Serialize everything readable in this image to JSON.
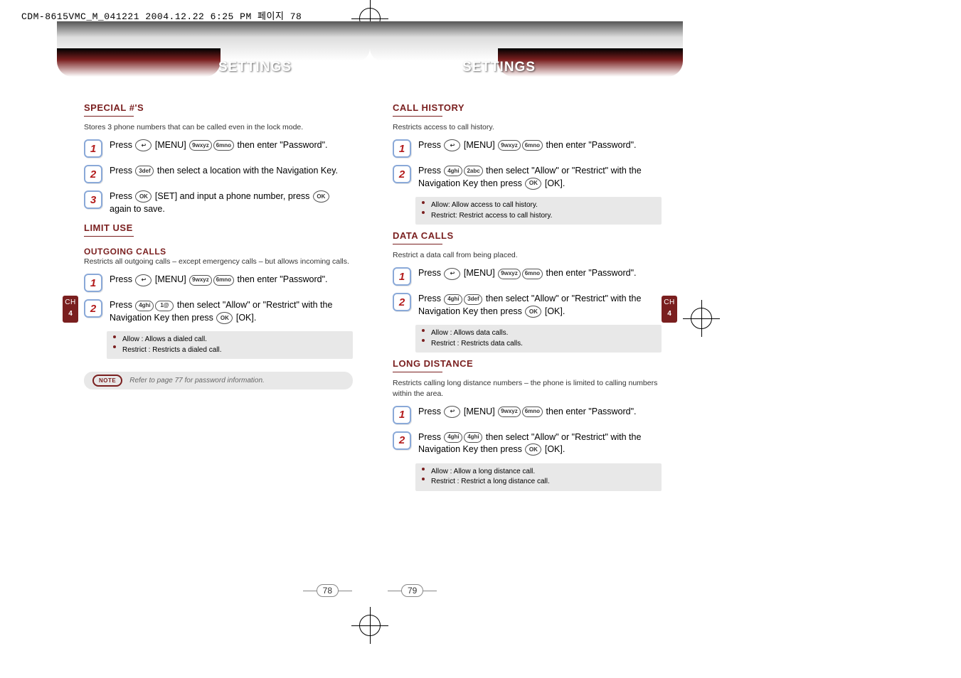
{
  "file_header": "CDM-8615VMC_M_041221  2004.12.22 6:25 PM  페이지 78",
  "chapter": {
    "label": "CH",
    "number": "4"
  },
  "left_page": {
    "header_title": "SETTINGS",
    "page_number": "78",
    "sections": [
      {
        "title": "SPECIAL #'S",
        "desc": "Stores 3 phone numbers that can be called even in the lock mode.",
        "steps": [
          {
            "n": "1",
            "pre": "Press ",
            "keys": [
              "↩",
              "[MENU]",
              "9wxyz",
              "6mno"
            ],
            "post": " then enter \"Password\"."
          },
          {
            "n": "2",
            "pre": "Press ",
            "keys": [
              "3def"
            ],
            "post": " then select a location with the Navigation Key."
          },
          {
            "n": "3",
            "pre": "Press ",
            "keys": [
              "OK"
            ],
            "mid": " [SET] and input a phone number, press ",
            "keys2": [
              "OK"
            ],
            "post": " again to save."
          }
        ]
      },
      {
        "title": "LIMIT USE",
        "subtitle": "OUTGOING CALLS",
        "desc": "Restricts all outgoing calls – except emergency calls – but allows incoming calls.",
        "steps": [
          {
            "n": "1",
            "pre": "Press ",
            "keys": [
              "↩",
              "[MENU]",
              "9wxyz",
              "6mno"
            ],
            "post": " then enter \"Password\"."
          },
          {
            "n": "2",
            "pre": "Press ",
            "keys": [
              "4ghi",
              "1@"
            ],
            "mid": " then select \"Allow\" or \"Restrict\" with the Navigation Key then press ",
            "keys2": [
              "OK"
            ],
            "post": " [OK]."
          }
        ],
        "bullets": [
          "Allow : Allows a dialed call.",
          "Restrict : Restricts a dialed call."
        ],
        "note": "Refer to page 77 for password information."
      }
    ]
  },
  "right_page": {
    "header_title": "SETTINGS",
    "page_number": "79",
    "sections": [
      {
        "title": "CALL HISTORY",
        "desc": "Restricts access to call history.",
        "steps": [
          {
            "n": "1",
            "pre": "Press ",
            "keys": [
              "↩",
              "[MENU]",
              "9wxyz",
              "6mno"
            ],
            "post": " then enter \"Password\"."
          },
          {
            "n": "2",
            "pre": "Press ",
            "keys": [
              "4ghi",
              "2abc"
            ],
            "mid": " then select \"Allow\" or \"Restrict\" with the Navigation Key then press ",
            "keys2": [
              "OK"
            ],
            "post": " [OK]."
          }
        ],
        "bullets": [
          "Allow: Allow access to call history.",
          "Restrict: Restrict access to call history."
        ]
      },
      {
        "title": "DATA CALLS",
        "desc": "Restrict a data call from being placed.",
        "steps": [
          {
            "n": "1",
            "pre": "Press ",
            "keys": [
              "↩",
              "[MENU]",
              "9wxyz",
              "6mno"
            ],
            "post": " then enter \"Password\"."
          },
          {
            "n": "2",
            "pre": "Press ",
            "keys": [
              "4ghi",
              "3def"
            ],
            "mid": " then select \"Allow\" or \"Restrict\" with the Navigation Key then press ",
            "keys2": [
              "OK"
            ],
            "post": " [OK]."
          }
        ],
        "bullets": [
          "Allow : Allows data calls.",
          "Restrict : Restricts data calls."
        ]
      },
      {
        "title": "LONG DISTANCE",
        "desc": "Restricts calling long distance numbers – the phone is limited to calling numbers within the area.",
        "steps": [
          {
            "n": "1",
            "pre": "Press ",
            "keys": [
              "↩",
              "[MENU]",
              "9wxyz",
              "6mno"
            ],
            "post": " then enter \"Password\"."
          },
          {
            "n": "2",
            "pre": "Press ",
            "keys": [
              "4ghi",
              "4ghi"
            ],
            "mid": " then select \"Allow\" or \"Restrict\" with the Navigation Key then press ",
            "keys2": [
              "OK"
            ],
            "post": " [OK]."
          }
        ],
        "bullets": [
          "Allow : Allow a long distance call.",
          "Restrict : Restrict a long distance call."
        ]
      }
    ]
  },
  "note_label": "NOTE"
}
